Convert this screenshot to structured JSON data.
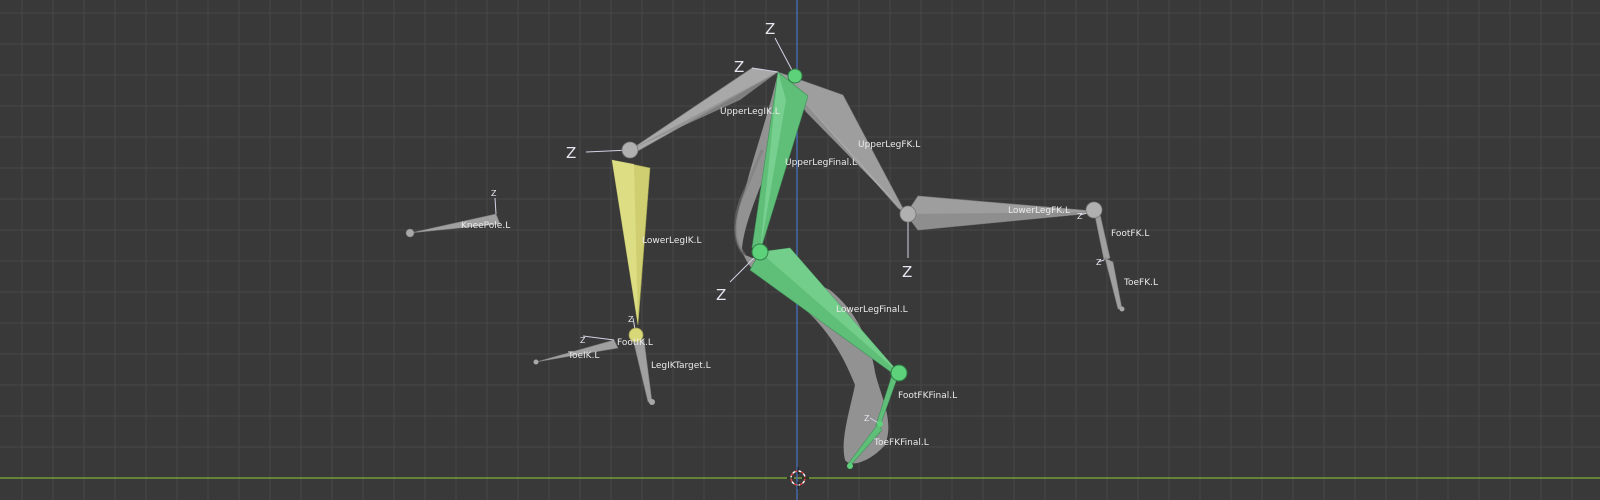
{
  "viewport": {
    "background": "#393939",
    "grid_color": "#474747",
    "x_axis_color": "#7fb03a",
    "y_axis_color": "#4a74c8",
    "cursor_icon": "3d-cursor-icon"
  },
  "colors": {
    "bone_gray": "#9e9e9e",
    "bone_ik": "#cfcf72",
    "bone_selected": "#5fbf78",
    "mesh": "#9a9a9a",
    "joint_green": "#5dd27a",
    "joint_yellow": "#d8d878",
    "joint_gray": "#b0b0b0"
  },
  "bones": {
    "upper_leg_ik": "UpperLegIK.L",
    "upper_leg_fk": "UpperLegFK.L",
    "upper_leg_final": "UpperLegFinal.L",
    "lower_leg_ik": "LowerLegIK.L",
    "lower_leg_fk": "LowerLegFK.L",
    "lower_leg_final": "LowerLegFinal.L",
    "knee_pole": "KneePole.L",
    "foot_ik": "FootIK.L",
    "toe_ik": "ToeIK.L",
    "leg_ik_target": "LegIKTarget.L",
    "foot_fk": "FootFK.L",
    "toe_fk": "ToeFK.L",
    "foot_fk_final": "FootFKFinal.L",
    "toe_fk_final": "ToeFKFinal.L"
  },
  "axis_label": "Z"
}
